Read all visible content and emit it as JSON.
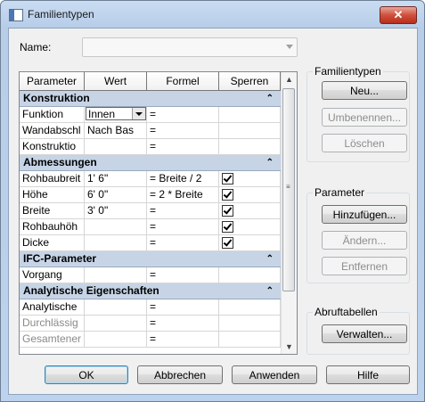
{
  "window": {
    "title": "Familientypen",
    "close_glyph": "✕"
  },
  "name": {
    "label": "Name:",
    "value": ""
  },
  "grid": {
    "headers": [
      "Parameter",
      "Wert",
      "Formel",
      "Sperren"
    ],
    "groups": [
      {
        "title": "Konstruktion",
        "rows": [
          {
            "param": "Funktion",
            "value": "Innen",
            "formula": "=",
            "locked": null,
            "gray": false,
            "combo": true
          },
          {
            "param": "Wandabschl",
            "value": "Nach Bas",
            "formula": "=",
            "locked": null,
            "gray": false
          },
          {
            "param": "Konstruktio",
            "value": "",
            "formula": "=",
            "locked": null,
            "gray": false
          }
        ]
      },
      {
        "title": "Abmessungen",
        "rows": [
          {
            "param": "Rohbaubreit",
            "value": "1'  6\"",
            "formula": "= Breite / 2",
            "locked": true,
            "gray": false
          },
          {
            "param": "Höhe",
            "value": "6'  0\"",
            "formula": "= 2 * Breite",
            "locked": true,
            "gray": false
          },
          {
            "param": "Breite",
            "value": "3'  0\"",
            "formula": "=",
            "locked": true,
            "gray": false
          },
          {
            "param": "Rohbauhöh",
            "value": "",
            "formula": "=",
            "locked": true,
            "gray": false
          },
          {
            "param": "Dicke",
            "value": "",
            "formula": "=",
            "locked": true,
            "gray": false
          }
        ]
      },
      {
        "title": "IFC-Parameter",
        "rows": [
          {
            "param": "Vorgang",
            "value": "",
            "formula": "=",
            "locked": null,
            "gray": false
          }
        ]
      },
      {
        "title": "Analytische Eigenschaften",
        "rows": [
          {
            "param": "Analytische",
            "value": "",
            "formula": "=",
            "locked": null,
            "gray": false
          },
          {
            "param": "Durchlässig",
            "value": "",
            "formula": "=",
            "locked": null,
            "gray": true
          },
          {
            "param": "Gesamtener",
            "value": "",
            "formula": "=",
            "locked": null,
            "gray": true
          }
        ]
      }
    ],
    "collapse_glyph": "⌃"
  },
  "familientypen": {
    "legend": "Familientypen",
    "new": "Neu...",
    "rename": "Umbenennen...",
    "delete": "Löschen"
  },
  "parameter": {
    "legend": "Parameter",
    "add": "Hinzufügen...",
    "modify": "Ändern...",
    "remove": "Entfernen"
  },
  "lookup": {
    "legend": "Abruftabellen",
    "manage": "Verwalten..."
  },
  "footer": {
    "ok": "OK",
    "cancel": "Abbrechen",
    "apply": "Anwenden",
    "help": "Hilfe"
  }
}
